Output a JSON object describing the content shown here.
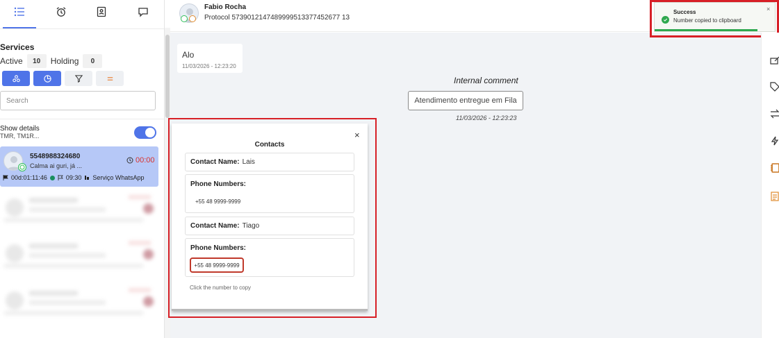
{
  "sidebar": {
    "tabs": [
      {
        "icon": "list-icon",
        "active": true
      },
      {
        "icon": "alarm-clock-icon",
        "active": false
      },
      {
        "icon": "contacts-book-icon",
        "active": false
      },
      {
        "icon": "chat-bubble-icon",
        "active": false
      }
    ],
    "services_title": "Services",
    "active_label": "Active",
    "active_count": "10",
    "holding_label": "Holding",
    "holding_count": "0",
    "search_placeholder": "Search",
    "show_details_label": "Show details",
    "show_details_sub": "TMR, TM1R...",
    "show_details_on": true,
    "conversation": {
      "phone": "5548988324680",
      "preview": "Calma ai guri, já ...",
      "timer": "00:00",
      "duration": "00d:01:11:46",
      "time": "09:30",
      "channel": "Serviço WhatsApp"
    }
  },
  "header": {
    "contact_name": "Fabio Rocha",
    "protocol": "Protocol 5739012147489999513377452677 13"
  },
  "chat": {
    "message_text": "Alo",
    "message_date": "11/03/2026 - 12:23:20",
    "internal_comment_label": "Internal comment",
    "internal_comment_text": "Atendimento entregue em Fila",
    "internal_comment_date": "11/03/2026 - 12:23:23"
  },
  "contacts_modal": {
    "close": "×",
    "title": "Contacts",
    "contact_name_label": "Contact Name:",
    "phone_numbers_label": "Phone Numbers:",
    "contacts": [
      {
        "name": "Lais",
        "phone": "+55 48 9999-9999"
      },
      {
        "name": "Tiago",
        "phone": "+55 48 9999-9999"
      }
    ],
    "hint": "Click the number to copy"
  },
  "toast": {
    "title": "Success",
    "message": "Number copied to clipboard",
    "close": "×"
  },
  "colors": {
    "accent": "#4f74e8",
    "highlight_red": "#d71f26",
    "success_green": "#2fa84f",
    "selected_row": "#b6c8f7"
  }
}
